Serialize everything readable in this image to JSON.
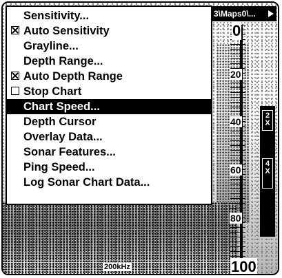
{
  "title": "3\\Maps0\\...",
  "menu": {
    "items": [
      {
        "label": "Sensitivity...",
        "check": "none",
        "selected": false
      },
      {
        "label": "Auto Sensitivity",
        "check": "checked",
        "selected": false
      },
      {
        "label": "Grayline...",
        "check": "none",
        "selected": false
      },
      {
        "label": "Depth Range...",
        "check": "none",
        "selected": false
      },
      {
        "label": "Auto Depth Range",
        "check": "checked",
        "selected": false
      },
      {
        "label": "Stop Chart",
        "check": "unchecked",
        "selected": false
      },
      {
        "label": "Chart Speed...",
        "check": "none",
        "selected": true
      },
      {
        "label": "Depth Cursor",
        "check": "none",
        "selected": false
      },
      {
        "label": "Overlay Data...",
        "check": "none",
        "selected": false
      },
      {
        "label": "Sonar Features...",
        "check": "none",
        "selected": false
      },
      {
        "label": "Ping Speed...",
        "check": "none",
        "selected": false
      },
      {
        "label": "Log Sonar Chart Data...",
        "check": "none",
        "selected": false
      }
    ]
  },
  "depth_scale": {
    "labels": [
      "0",
      "20",
      "40",
      "60",
      "80",
      "100"
    ]
  },
  "zoom": {
    "levels": [
      "2X",
      "4X"
    ]
  },
  "frequency": "200kHz",
  "icons": {
    "title_arrow": "right-arrow-icon",
    "checkbox": "checkbox-icon"
  },
  "colors": {
    "foreground": "#000000",
    "background": "#ffffff",
    "selection": "#000000"
  }
}
